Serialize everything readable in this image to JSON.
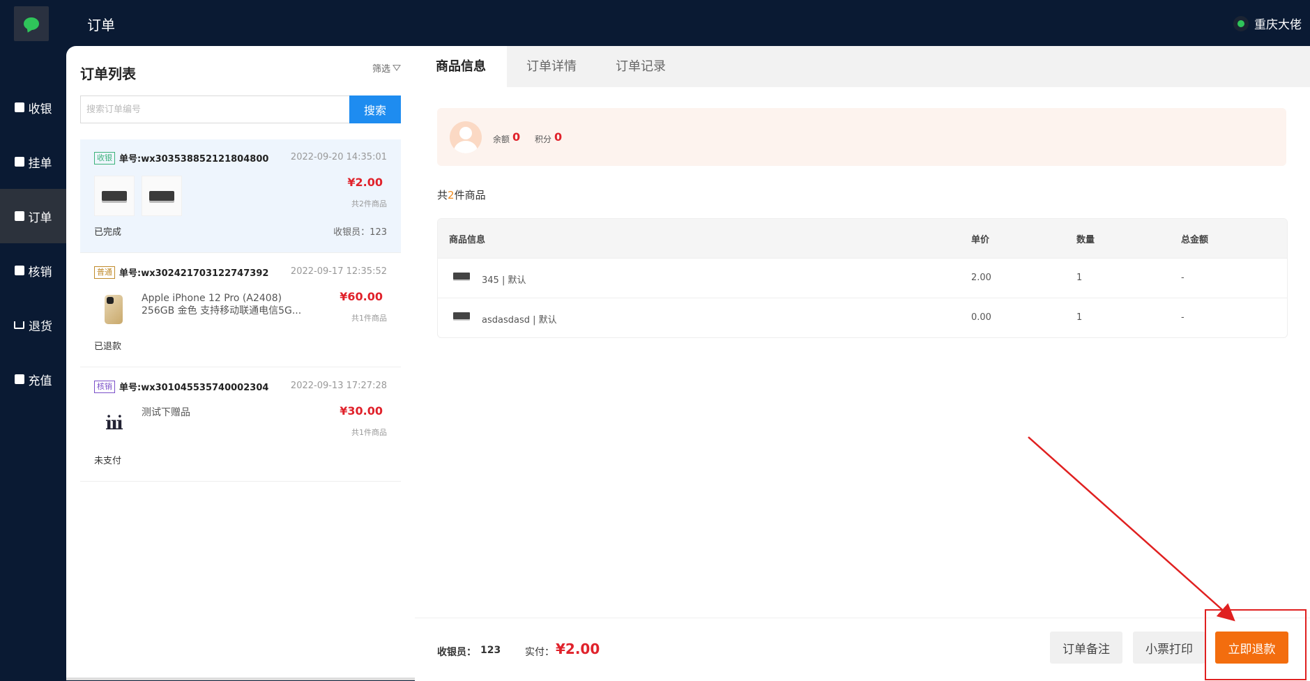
{
  "header": {
    "title": "订单",
    "user": "重庆大佬"
  },
  "sidebar": {
    "items": [
      {
        "label": "收银",
        "icon": "cashier-icon"
      },
      {
        "label": "挂单",
        "icon": "hold-icon"
      },
      {
        "label": "订单",
        "icon": "order-icon",
        "active": true
      },
      {
        "label": "核销",
        "icon": "verify-icon"
      },
      {
        "label": "退货",
        "icon": "cart-icon"
      },
      {
        "label": "充值",
        "icon": "recharge-icon"
      }
    ]
  },
  "order_list": {
    "title": "订单列表",
    "filter_label": "筛选",
    "search_placeholder": "搜索订单编号",
    "search_button": "搜索",
    "orders": [
      {
        "badge": "收银",
        "order_no": "单号:wx303538852121804800",
        "time": "2022-09-20 14:35:01",
        "price": "¥2.00",
        "count": "共2件商品",
        "status": "已完成",
        "cashier": "收银员：123"
      },
      {
        "badge": "普通",
        "order_no": "单号:wx302421703122747392",
        "time": "2022-09-17 12:35:52",
        "product": "Apple iPhone 12 Pro (A2408) 256GB 金色 支持移动联通电信5G...",
        "price": "¥60.00",
        "count": "共1件商品",
        "status": "已退款"
      },
      {
        "badge": "核销",
        "order_no": "单号:wx301045535740002304",
        "time": "2022-09-13 17:27:28",
        "product": "测试下赠品",
        "price": "¥30.00",
        "count": "共1件商品",
        "status": "未支付"
      }
    ]
  },
  "tabs": [
    "商品信息",
    "订单详情",
    "订单记录"
  ],
  "member": {
    "balance_label": "余额",
    "balance": "0",
    "points_label": "积分",
    "points": "0"
  },
  "goods_summary": {
    "prefix": "共",
    "count": "2",
    "suffix": "件商品"
  },
  "goods_table": {
    "headers": [
      "商品信息",
      "单价",
      "数量",
      "总金额"
    ],
    "rows": [
      {
        "name": "345 | 默认",
        "price": "2.00",
        "qty": "1",
        "total": "-"
      },
      {
        "name": "asdasdasd | 默认",
        "price": "0.00",
        "qty": "1",
        "total": "-"
      }
    ]
  },
  "footer": {
    "cashier_label": "收银员：",
    "cashier": "123",
    "paid_label": "实付：",
    "paid": "¥2.00",
    "btn_note": "订单备注",
    "btn_print": "小票打印",
    "btn_refund": "立即退款"
  },
  "colors": {
    "accent": "#1e8cf0",
    "refund": "#f36d0e",
    "price": "#e0222b",
    "nav_bg": "#0a1a33"
  }
}
